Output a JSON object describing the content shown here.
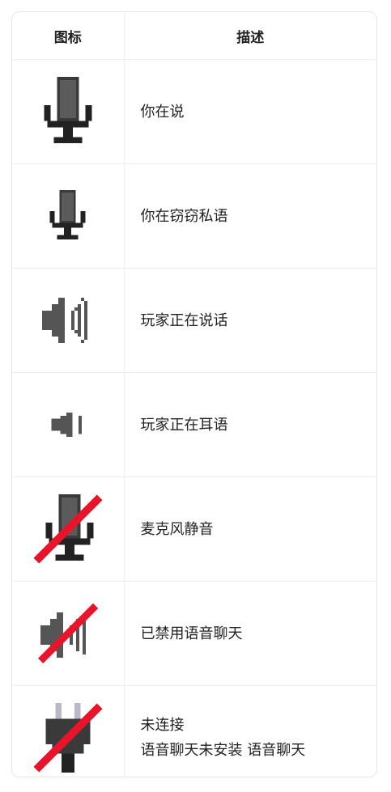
{
  "header": {
    "icon_col": "图标",
    "desc_col": "描述"
  },
  "rows": [
    {
      "icon": "microphone-icon",
      "desc": "你在说"
    },
    {
      "icon": "small-microphone-icon",
      "desc": "你在窃窃私语"
    },
    {
      "icon": "speaker-loud-icon",
      "desc": "玩家正在说话"
    },
    {
      "icon": "speaker-quiet-icon",
      "desc": "玩家正在耳语"
    },
    {
      "icon": "microphone-muted-icon",
      "desc": "麦克风静音"
    },
    {
      "icon": "speaker-disabled-icon",
      "desc": "已禁用语音聊天"
    },
    {
      "icon": "plug-disconnected-icon",
      "desc": "未连接",
      "desc2": "语音聊天未安装 语音聊天"
    }
  ],
  "colors": {
    "icon_dark": "#2c2c2c",
    "icon_gray": "#5a5a5a",
    "strike_red": "#e8152a",
    "plug_prong": "#b9b9c8"
  }
}
